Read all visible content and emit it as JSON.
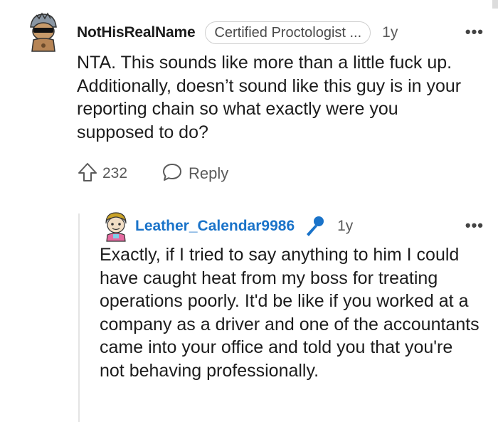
{
  "comment": {
    "username": "NotHisRealName",
    "flair": "Certified Proctologist ...",
    "time": "1y",
    "more_icon": "more-options-icon",
    "body": "NTA. This sounds like more than a little fuck up. Additionally, doesn’t sound like this guy is in your reporting chain so what exactly were you supposed to do?",
    "upvotes": "232",
    "reply_label": "Reply"
  },
  "reply": {
    "username": "Leather_Calendar9986",
    "badge_icon": "microphone-icon",
    "time": "1y",
    "more_icon": "more-options-icon",
    "body": "Exactly, if I tried to say anything to him I could have caught heat from my boss for treating operations poorly. It'd be like if you worked at a company as a driver and one of the accountants came into your office and told you that you're not behaving professionally."
  },
  "colors": {
    "accent_blue": "#1a73c9",
    "text": "#1c1c1c",
    "muted": "#5a5a5a"
  }
}
